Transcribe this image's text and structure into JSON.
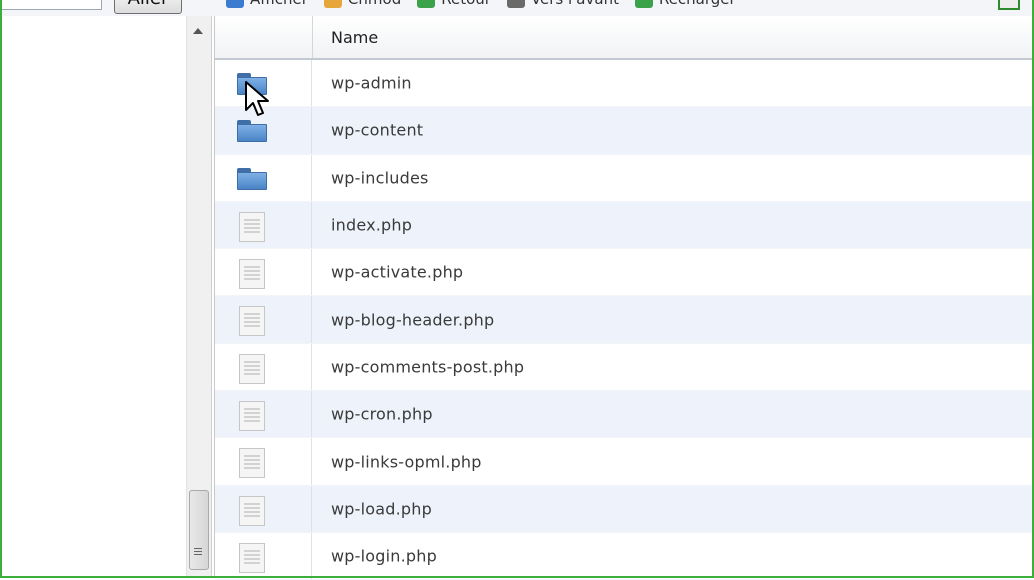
{
  "toolbar": {
    "go_button": "Aller",
    "items": [
      {
        "label": "Afficher",
        "icon": "view-icon",
        "color": "#3b7bd0"
      },
      {
        "label": "Chmod",
        "icon": "folder-key-icon",
        "color": "#e7a63a"
      },
      {
        "label": "Retour",
        "icon": "back-arrow-icon",
        "color": "#3aa34a"
      },
      {
        "label": "Vers l'avant",
        "icon": "forward-arrow-icon",
        "color": "#6a6a6a"
      },
      {
        "label": "Recharger",
        "icon": "refresh-icon",
        "color": "#3aa34a"
      }
    ]
  },
  "file_list": {
    "column_name": "Name",
    "items": [
      {
        "name": "wp-admin",
        "type": "folder"
      },
      {
        "name": "wp-content",
        "type": "folder"
      },
      {
        "name": "wp-includes",
        "type": "folder"
      },
      {
        "name": "index.php",
        "type": "file"
      },
      {
        "name": "wp-activate.php",
        "type": "file"
      },
      {
        "name": "wp-blog-header.php",
        "type": "file"
      },
      {
        "name": "wp-comments-post.php",
        "type": "file"
      },
      {
        "name": "wp-cron.php",
        "type": "file"
      },
      {
        "name": "wp-links-opml.php",
        "type": "file"
      },
      {
        "name": "wp-load.php",
        "type": "file"
      },
      {
        "name": "wp-login.php",
        "type": "file"
      }
    ]
  },
  "colors": {
    "frame": "#3cae3c",
    "row_alt": "#eef3fb",
    "folder": "#4a84c6"
  }
}
